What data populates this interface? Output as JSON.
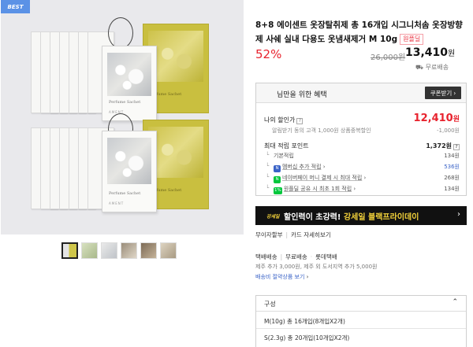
{
  "gallery": {
    "badge": "BEST",
    "sachet_caption": "Perfume Sachet",
    "sachet_brand": "AMENT",
    "thumbnails": [
      "thumb-1",
      "thumb-2",
      "thumb-3",
      "thumb-4",
      "thumb-5",
      "thumb-6"
    ],
    "active_thumbnail": 0
  },
  "product": {
    "title": "8+8 에이센트 옷장탈취제 총 16개입 시그니처솜 옷장방향제 사쉐 실내 다용도 옷냄새제거 M 10g",
    "deal_tag": "원플딜",
    "discount": "52%",
    "original_price": "26,000원",
    "sale_price": "13,410",
    "sale_unit": "원",
    "shipping": "무료배송"
  },
  "benefits": {
    "title": "님만을 위한 혜택",
    "coupon_button": "쿠폰받기",
    "my_price_label": "나의 할인가",
    "my_price_note": "알림받기 동의 고객 1,000원 상품중복할인",
    "my_price": "12,410",
    "my_price_unit": "원",
    "my_price_discount": "-1,000원",
    "points_label": "최대 적립 포인트",
    "points_total": "1,372원",
    "points": [
      {
        "icon": "",
        "label": "기본적립",
        "value": "134원",
        "color": "#555555"
      },
      {
        "icon": "N",
        "label": "멤버십 추가 적립",
        "value": "536원",
        "color": "#3a63c7",
        "icon_color": "#3a63c7"
      },
      {
        "icon": "N",
        "label": "네이버페이 머니 결제 시 최대 적립",
        "value": "268원",
        "color": "#555555",
        "icon_color": "#00c73c"
      },
      {
        "icon": "1%",
        "label": "원플딜 공유 시 최초 1회 적립",
        "value": "134원",
        "color": "#555555",
        "icon_color": "#00c73c"
      }
    ]
  },
  "promo": {
    "tag": "강세일",
    "text_plain": "할인력이 초강력! ",
    "text_highlight": "강세일 블랙프라이데이",
    "arrow": "›"
  },
  "payment": {
    "interest_free": "무이자할부",
    "card_benefit": "카드 자세히보기"
  },
  "delivery": {
    "label": "택배배송",
    "fee": "무료배송",
    "carrier": "롯데택배",
    "extra_fee": "제주 추가 3,000원, 제주 외 도서지역 추가 5,000원",
    "save_link": "배송비 절약상품 보기"
  },
  "options": {
    "label": "구성",
    "items": [
      "M(10g) 총 16개입(8개입X2개)",
      "S(2.3g) 총 20개입(10개입X2개)"
    ]
  },
  "colors": {
    "accent_red": "#e8232e",
    "link_blue": "#3a63c7",
    "promo_yellow": "#f2d13a",
    "badge_blue": "#5b92e6"
  }
}
